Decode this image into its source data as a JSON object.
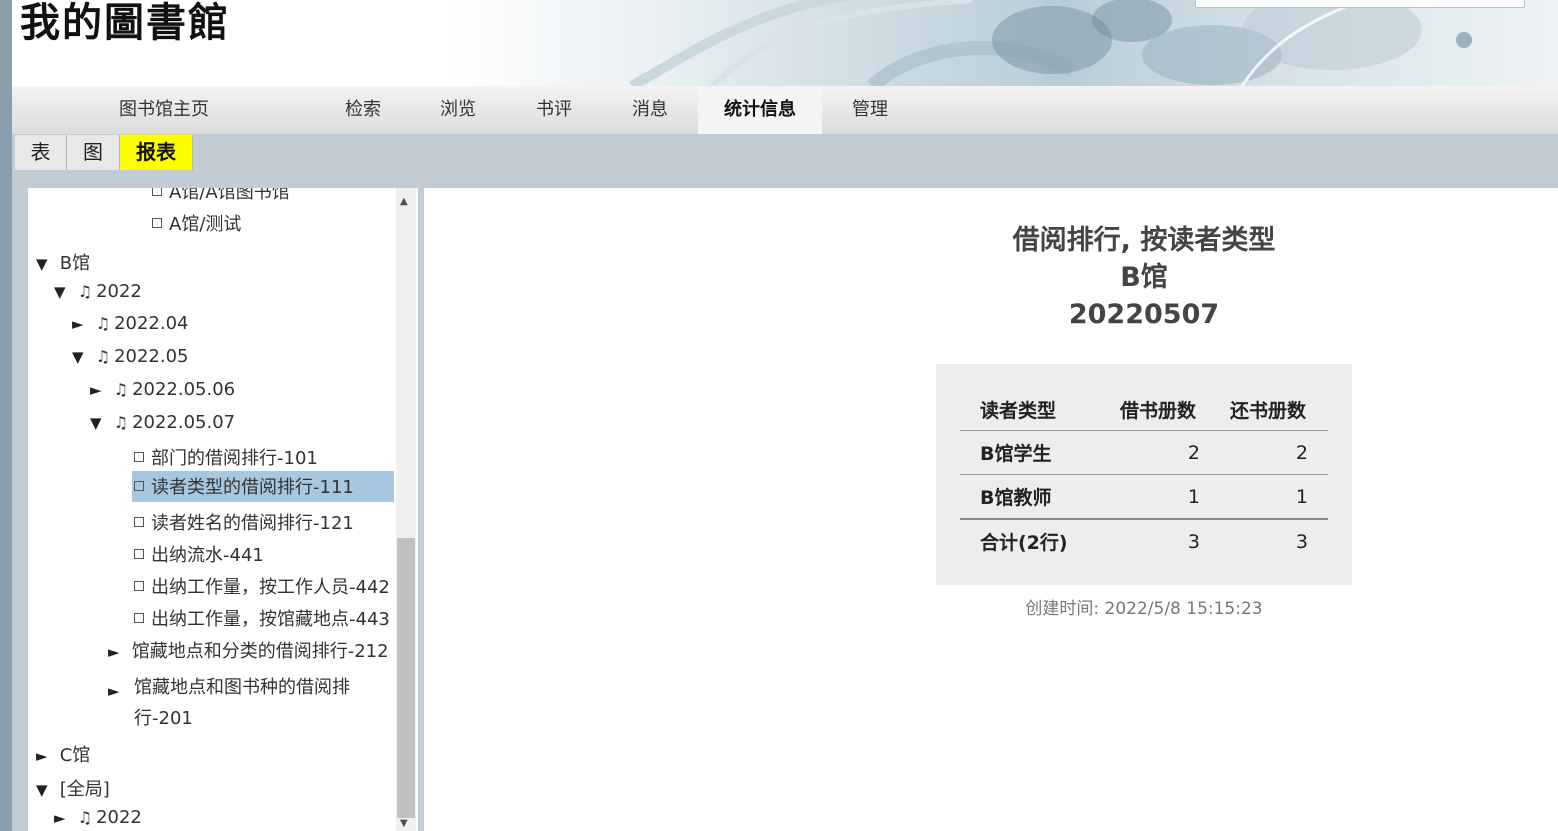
{
  "header": {
    "logo_text": "我的圖書館"
  },
  "topnav": {
    "items": [
      "图书馆主页",
      "检索",
      "浏览",
      "书评",
      "消息",
      "统计信息",
      "管理"
    ],
    "active": "统计信息"
  },
  "subtabs": {
    "items": [
      "表",
      "图",
      "报表"
    ],
    "active": "报表"
  },
  "tree": {
    "rows": [
      {
        "label": "A馆/A馆图书馆",
        "toggle": "",
        "kind": "leaf"
      },
      {
        "label": "A馆/测试",
        "toggle": "",
        "kind": "leaf"
      },
      {
        "label": "B馆",
        "toggle": "▼",
        "kind": "lib"
      },
      {
        "label": "2022",
        "toggle": "▼",
        "kind": "date"
      },
      {
        "label": "2022.04",
        "toggle": "►",
        "kind": "date"
      },
      {
        "label": "2022.05",
        "toggle": "▼",
        "kind": "date"
      },
      {
        "label": "2022.05.06",
        "toggle": "►",
        "kind": "date"
      },
      {
        "label": "2022.05.07",
        "toggle": "▼",
        "kind": "date"
      },
      {
        "label": "部门的借阅排行-101",
        "toggle": "",
        "kind": "leaf"
      },
      {
        "label": "读者类型的借阅排行-111",
        "toggle": "",
        "kind": "leaf",
        "selected": true
      },
      {
        "label": "读者姓名的借阅排行-121",
        "toggle": "",
        "kind": "leaf"
      },
      {
        "label": "出纳流水-441",
        "toggle": "",
        "kind": "leaf"
      },
      {
        "label": "出纳工作量，按工作人员-442",
        "toggle": "",
        "kind": "leaf"
      },
      {
        "label": "出纳工作量，按馆藏地点-443",
        "toggle": "",
        "kind": "leaf"
      },
      {
        "label": "馆藏地点和分类的借阅排行-212",
        "toggle": "►",
        "kind": "group"
      },
      {
        "label": "馆藏地点和图书种的借阅排",
        "label2": "行-201",
        "toggle": "►",
        "kind": "group"
      },
      {
        "label": "C馆",
        "toggle": "►",
        "kind": "lib"
      },
      {
        "label": "[全局]",
        "toggle": "▼",
        "kind": "lib"
      },
      {
        "label": "2022",
        "toggle": "►",
        "kind": "date"
      }
    ]
  },
  "report": {
    "title_line1": "借阅排行, 按读者类型",
    "title_line2": "B馆",
    "title_line3": "20220507",
    "columns": [
      "读者类型",
      "借书册数",
      "还书册数"
    ],
    "rows": [
      [
        "B馆学生",
        "2",
        "2"
      ],
      [
        "B馆教师",
        "1",
        "1"
      ],
      [
        "合计(2行)",
        "3",
        "3"
      ]
    ],
    "created": "创建时间: 2022/5/8 15:15:23"
  },
  "icons": {
    "note": "♫",
    "square": "checkbox-square-icon"
  }
}
